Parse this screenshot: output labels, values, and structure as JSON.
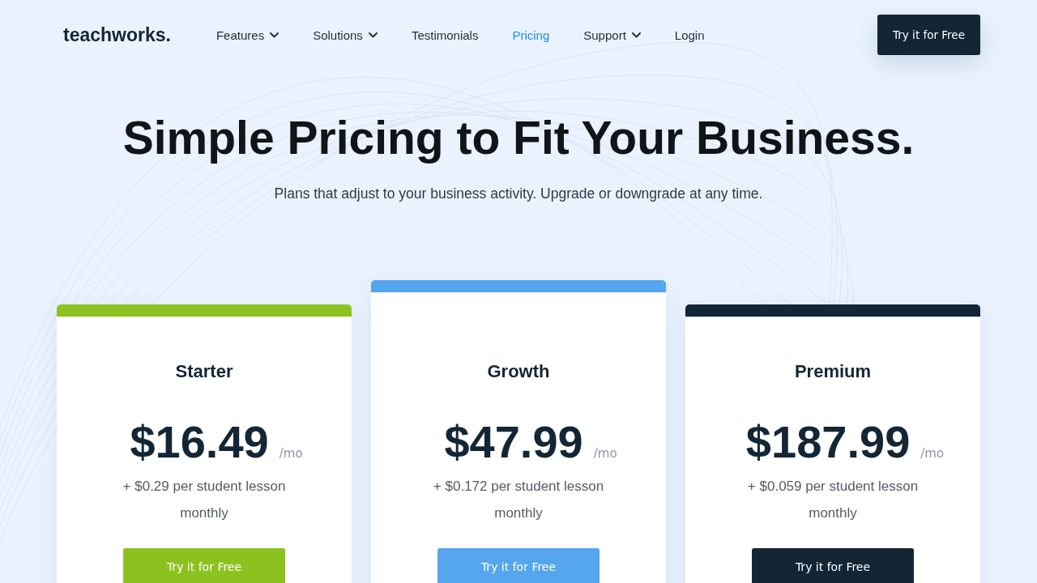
{
  "header": {
    "logo": "teachworks.",
    "nav": [
      {
        "label": "Features",
        "has_menu": true,
        "selected": false
      },
      {
        "label": "Solutions",
        "has_menu": true,
        "selected": false
      },
      {
        "label": "Testimonials",
        "has_menu": false,
        "selected": false
      },
      {
        "label": "Pricing",
        "has_menu": false,
        "selected": true
      },
      {
        "label": "Support",
        "has_menu": true,
        "selected": false
      },
      {
        "label": "Login",
        "has_menu": false,
        "selected": false
      }
    ],
    "cta": "Try it for Free"
  },
  "hero": {
    "title": "Simple Pricing to Fit Your Business.",
    "subtitle": "Plans that adjust to your business activity. Upgrade or downgrade at any time."
  },
  "plans": [
    {
      "name": "Starter",
      "price": "$16.49",
      "period": "/mo",
      "note": "+ $0.29 per student lesson monthly",
      "button": "Try it for Free",
      "color": "#8cc220",
      "featured": false
    },
    {
      "name": "Growth",
      "price": "$47.99",
      "period": "/mo",
      "note": "+ $0.172 per student lesson monthly",
      "button": "Try it for Free",
      "color": "#55a5ef",
      "featured": true
    },
    {
      "name": "Premium",
      "price": "$187.99",
      "period": "/mo",
      "note": "+ $0.059 per student lesson monthly",
      "button": "Try it for Free",
      "color": "#132636",
      "featured": false
    }
  ]
}
